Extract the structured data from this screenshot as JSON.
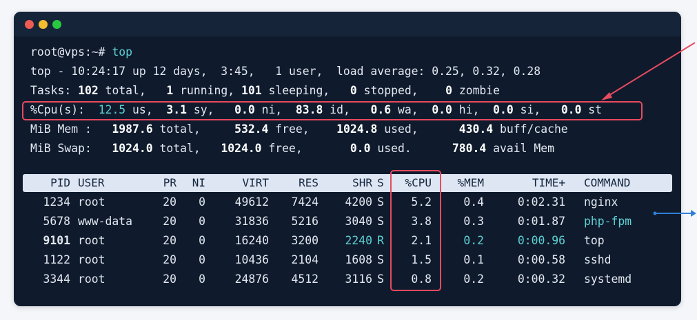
{
  "prompt": "root@vps:~#",
  "command": "top",
  "uptime_line": "top - 10:24:17 up 12 days,  3:45,   1 user,  load average: 0.25, 0.32, 0.28",
  "tasks": {
    "label": "Tasks:",
    "total": "102",
    "total_label": "total,",
    "running": "1",
    "running_label": "running,",
    "sleeping": "101",
    "sleeping_label": "sleeping,",
    "stopped": "0",
    "stopped_label": "stopped,",
    "zombie": "0",
    "zombie_label": "zombie"
  },
  "cpu": {
    "label": "%Cpu(s):",
    "us": "12.5",
    "sy": "3.1",
    "ni": "0.0",
    "id": "83.8",
    "wa": "0.6",
    "hi": "0.0",
    "si": "0.0",
    "st": "0.0"
  },
  "mem": {
    "label": "MiB Mem :",
    "total": "1987.6",
    "free": "532.4",
    "used": "1024.8",
    "buff": "430.4",
    "total_label": "total,",
    "free_label": "free,",
    "used_label": "used,",
    "buff_label": "buff/cache"
  },
  "swap": {
    "label": "MiB Swap:",
    "total": "1024.0",
    "free": "1024.0",
    "used": "0.0",
    "avail": "780.4",
    "total_label": "total,",
    "free_label": "free,",
    "used_label": "used.",
    "avail_label": "avail Mem"
  },
  "columns": [
    "PID",
    "USER",
    "PR",
    "NI",
    "VIRT",
    "RES",
    "SHR",
    "S",
    "%CPU",
    "%MEM",
    "TIME+",
    "COMMAND"
  ],
  "processes": [
    {
      "pid": "1234",
      "user": "root",
      "pr": "20",
      "ni": "0",
      "virt": "49612",
      "res": "7424",
      "shr": "4200",
      "s": "S",
      "cpu": "5.2",
      "mem": "0.4",
      "time": "0:02.31",
      "command": "nginx",
      "highlight": false
    },
    {
      "pid": "5678",
      "user": "www-data",
      "pr": "20",
      "ni": "0",
      "virt": "31836",
      "res": "5216",
      "shr": "3040",
      "s": "S",
      "cpu": "3.8",
      "mem": "0.3",
      "time": "0:01.87",
      "command": "php-fpm",
      "highlight": false
    },
    {
      "pid": "9101",
      "user": "root",
      "pr": "20",
      "ni": "0",
      "virt": "16240",
      "res": "3200",
      "shr": "2240",
      "s": "R",
      "cpu": "2.1",
      "mem": "0.2",
      "time": "0:00.96",
      "command": "top",
      "highlight": true
    },
    {
      "pid": "1122",
      "user": "root",
      "pr": "20",
      "ni": "0",
      "virt": "10436",
      "res": "2104",
      "shr": "1608",
      "s": "S",
      "cpu": "1.5",
      "mem": "0.1",
      "time": "0:00.58",
      "command": "sshd",
      "highlight": false
    },
    {
      "pid": "3344",
      "user": "root",
      "pr": "20",
      "ni": "0",
      "virt": "24876",
      "res": "4512",
      "shr": "3116",
      "s": "S",
      "cpu": "0.8",
      "mem": "0.2",
      "time": "0:00.32",
      "command": "systemd",
      "highlight": false
    }
  ],
  "colors": {
    "background": "#0f1b2d",
    "highlight_box": "#e84a5f",
    "accent_cyan": "#5ed1d3",
    "annotation_blue": "#2f7fd8"
  }
}
